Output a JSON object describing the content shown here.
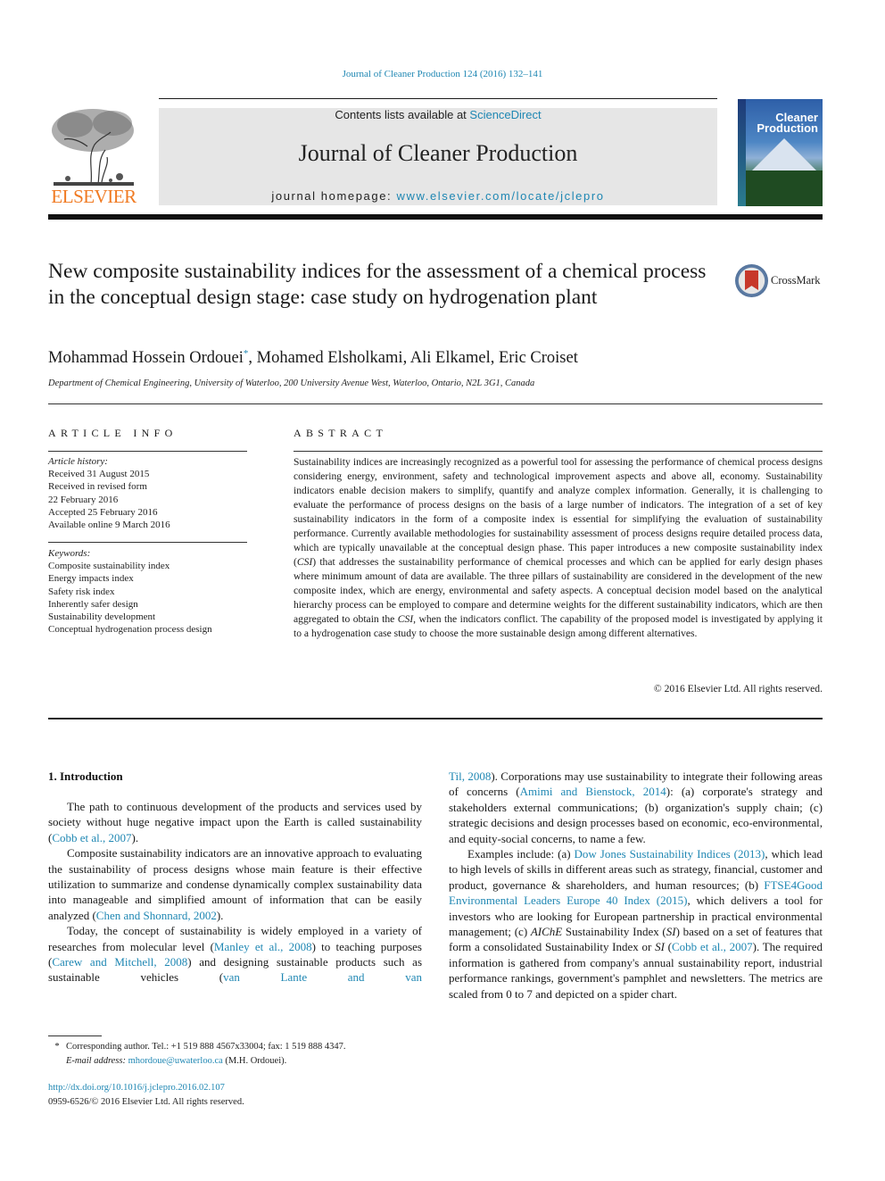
{
  "citation": "Journal of Cleaner Production 124 (2016) 132–141",
  "header": {
    "publisher": "ELSEVIER",
    "contents_prefix": "Contents lists available at ",
    "contents_link": "ScienceDirect",
    "journal_title": "Journal of Cleaner Production",
    "homepage_prefix": "journal homepage: ",
    "homepage_link": "www.elsevier.com/locate/jclepro",
    "cover_title_line1": "Cleaner",
    "cover_title_line2": "Production",
    "brand_color": "#f07a22",
    "link_color": "#1f87b3"
  },
  "article": {
    "title": "New composite sustainability indices for the assessment of a chemical process in the conceptual design stage: case study on hydrogenation plant",
    "crossmark_label": "CrossMark",
    "authors": [
      {
        "name": "Mohammad Hossein Ordouei",
        "mark": "*"
      },
      {
        "name": "Mohamed Elsholkami"
      },
      {
        "name": "Ali Elkamel"
      },
      {
        "name": "Eric Croiset"
      }
    ],
    "authors_sep": ", ",
    "affiliation": "Department of Chemical Engineering, University of Waterloo, 200 University Avenue West, Waterloo, Ontario, N2L 3G1, Canada"
  },
  "article_info": {
    "heading": "ARTICLE INFO",
    "history_label": "Article history:",
    "history": [
      "Received 31 August 2015",
      "Received in revised form",
      "22 February 2016",
      "Accepted 25 February 2016",
      "Available online 9 March 2016"
    ],
    "keywords_label": "Keywords:",
    "keywords": [
      "Composite sustainability index",
      "Energy impacts index",
      "Safety risk index",
      "Inherently safer design",
      "Sustainability development",
      "Conceptual hydrogenation process design"
    ]
  },
  "abstract": {
    "heading": "ABSTRACT",
    "part1": "Sustainability indices are increasingly recognized as a powerful tool for assessing the performance of chemical process designs considering energy, environment, safety and technological improvement aspects and above all, economy. Sustainability indicators enable decision makers to simplify, quantify and analyze complex information. Generally, it is challenging to evaluate the performance of process designs on the basis of a large number of indicators. The integration of a set of key sustainability indicators in the form of a composite index is essential for simplifying the evaluation of sustainability performance. Currently available methodologies for sustainability assessment of process designs require detailed process data, which are typically unavailable at the conceptual design phase. This paper introduces a new composite sustainability index (",
    "csi_1": "CSI",
    "part2": ") that addresses the sustainability performance of chemical processes and which can be applied for early design phases where minimum amount of data are available. The three pillars of sustainability are considered in the development of the new composite index, which are energy, environmental and safety aspects. A conceptual decision model based on the analytical hierarchy process can be employed to compare and determine weights for the different sustainability indicators, which are then aggregated to obtain the ",
    "csi_2": "CSI",
    "part3": ", when the indicators conflict. The capability of the proposed model is investigated by applying it to a hydrogenation case study to choose the more sustainable design among different alternatives.",
    "copyright": "© 2016 Elsevier Ltd. All rights reserved."
  },
  "introduction": {
    "heading": "1.  Introduction",
    "left": {
      "p1_a": "The path to continuous development of the products and services used by society without huge negative impact upon the Earth is called sustainability (",
      "p1_ref": "Cobb et al., 2007",
      "p1_b": ").",
      "p2_a": "Composite sustainability indicators are an innovative approach to evaluating the sustainability of process designs whose main feature is their effective utilization to summarize and condense dynamically complex sustainability data into manageable and simplified amount of information that can be easily analyzed (",
      "p2_ref": "Chen and Shonnard, 2002",
      "p2_b": ").",
      "p3_a": "Today, the concept of sustainability is widely employed in a variety of researches from molecular level (",
      "p3_ref1": "Manley et al., 2008",
      "p3_b": ") to teaching purposes (",
      "p3_ref2": "Carew and Mitchell, 2008",
      "p3_c": ") and designing sustainable products such as sustainable vehicles (",
      "p3_ref3": "van Lante and van"
    },
    "right": {
      "p3_ref3_cont": "Til, 2008",
      "p3_d": "). Corporations may use sustainability to integrate their following areas of concerns (",
      "p3_ref4": "Amimi and Bienstock, 2014",
      "p3_e": "): (a) corporate's strategy and stakeholders external communications; (b) organization's supply chain; (c) strategic decisions and design processes based on economic, eco-environmental, and equity-social concerns, to name a few.",
      "p4_a": "Examples include: (a) ",
      "p4_ref1": "Dow Jones Sustainability Indices (2013)",
      "p4_b": ", which lead to high levels of skills in different areas such as strategy, financial, customer and product, governance & shareholders, and human resources; (b) ",
      "p4_ref2": "FTSE4Good Environmental Leaders Europe 40 Index (2015)",
      "p4_c": ", which delivers a tool for investors who are looking for European partnership in practical environmental management; (c) ",
      "p4_aiche": "AIChE",
      "p4_d": " Sustainability Index (",
      "p4_si1": "SI",
      "p4_e": ") based on a set of features that form a consolidated Sustainability Index or ",
      "p4_si2": "SI",
      "p4_f": " (",
      "p4_ref3": "Cobb et al., 2007",
      "p4_g": "). The required information is gathered from company's annual sustainability report, industrial performance rankings, government's pamphlet and newsletters. The metrics are scaled from 0 to 7 and depicted on a spider chart."
    }
  },
  "footnote": {
    "star": "*",
    "corresponding": "Corresponding author. Tel.: +1 519 888 4567x33004; fax: 1 519 888 4347.",
    "email_label": "E-mail address: ",
    "email": "mhordoue@uwaterloo.ca",
    "email_owner": " (M.H. Ordouei).",
    "doi": "http://dx.doi.org/10.1016/j.jclepro.2016.02.107",
    "issn": "0959-6526/© 2016 Elsevier Ltd. All rights reserved."
  }
}
